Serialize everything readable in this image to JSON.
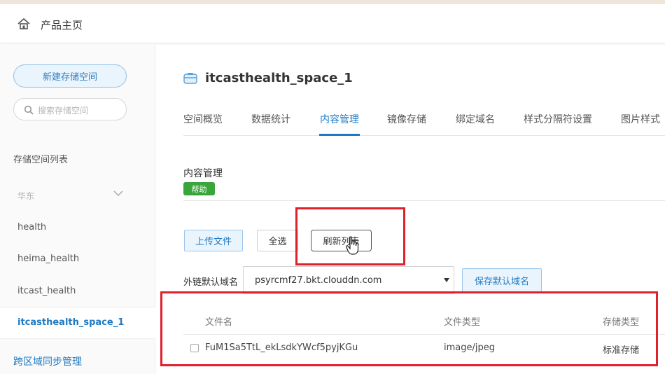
{
  "header": {
    "title": "产品主页"
  },
  "sidebar": {
    "new_bucket_label": "新建存储空间",
    "search_placeholder": "搜索存储空间",
    "list_title": "存储空间列表",
    "region": "华东",
    "items": [
      {
        "label": "health"
      },
      {
        "label": "heima_health"
      },
      {
        "label": "itcast_health"
      },
      {
        "label": "itcasthealth_space_1",
        "active": true
      }
    ],
    "cross_region_label": "跨区域同步管理"
  },
  "bucket": {
    "name": "itcasthealth_space_1"
  },
  "tabs": [
    {
      "label": "空间概览"
    },
    {
      "label": "数据统计"
    },
    {
      "label": "内容管理",
      "active": true
    },
    {
      "label": "镜像存储"
    },
    {
      "label": "绑定域名"
    },
    {
      "label": "样式分隔符设置"
    },
    {
      "label": "图片样式"
    }
  ],
  "content": {
    "section_title": "内容管理",
    "help_label": "帮助",
    "upload_label": "上传文件",
    "select_all_label": "全选",
    "refresh_label": "刷新列表",
    "domain_label": "外链默认域名",
    "domain_value": "psyrcmf27.bkt.clouddn.com",
    "save_domain_label": "保存默认域名"
  },
  "table": {
    "columns": [
      "文件名",
      "文件类型",
      "存储类型"
    ],
    "rows": [
      {
        "name": "FuM1Sa5TtL_ekLsdkYWcf5pyjKGu",
        "type": "image/jpeg",
        "storage": "标准存储"
      }
    ]
  },
  "colors": {
    "accent": "#1f7ac3",
    "help_green": "#3aa53a",
    "annotation_red": "#e0202a"
  }
}
